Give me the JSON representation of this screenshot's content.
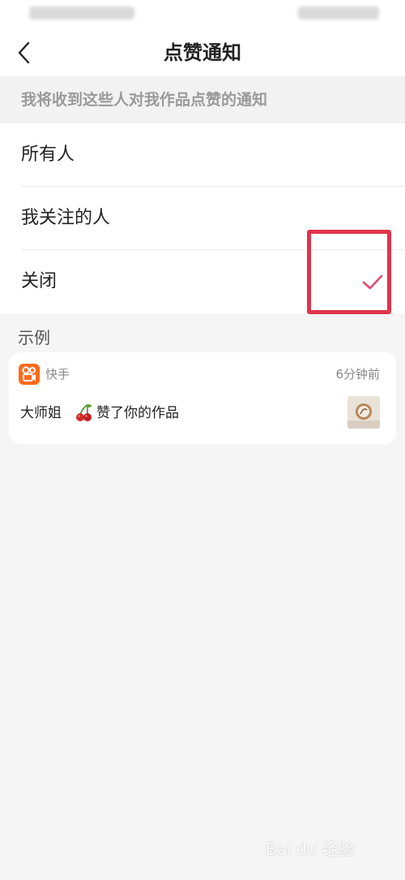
{
  "nav": {
    "title": "点赞通知"
  },
  "section_header": "我将收到这些人对我作品点赞的通知",
  "options": [
    {
      "label": "所有人",
      "selected": false
    },
    {
      "label": "我关注的人",
      "selected": false
    },
    {
      "label": "关闭",
      "selected": true
    }
  ],
  "example": {
    "label": "示例",
    "app_name": "快手",
    "time_ago": "6分钟前",
    "user_name": "大师姐",
    "action_text": "赞了你的作品"
  },
  "watermark": "Bai du 经验",
  "colors": {
    "accent": "#e04a6f",
    "highlight_box": "#e0344c",
    "app_icon": "#ff6a1a"
  },
  "icons": {
    "back": "chevron-left-icon",
    "check": "check-icon",
    "app": "kuaishou-app-icon",
    "emoji": "cherry-icon"
  }
}
